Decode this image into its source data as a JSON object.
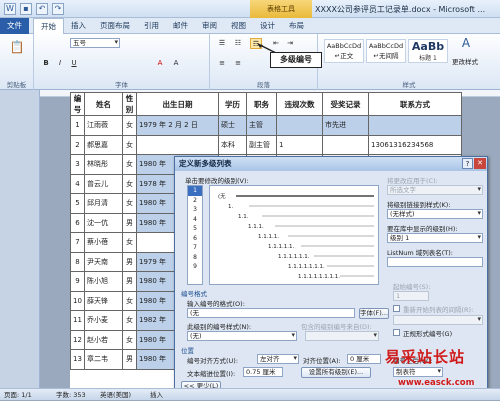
{
  "window": {
    "title": "XXXX公司参评员工记录单.docx - Microsoft ...",
    "context_tab": "表格工具"
  },
  "ribbon_tabs": [
    "文件",
    "开始",
    "插入",
    "页面布局",
    "引用",
    "邮件",
    "审阅",
    "视图",
    "设计",
    "布局"
  ],
  "ribbon": {
    "groups": [
      "剪贴板",
      "字体",
      "段落",
      "样式"
    ],
    "font_size": "五号",
    "styles": [
      "AaBbCcDd",
      "AaBbCcDd",
      "AaBb"
    ],
    "style_names": [
      "↵正文",
      "↵无间隔",
      "标题 1"
    ],
    "change_styles": "更改样式",
    "callout": "多级编号"
  },
  "table": {
    "headers": [
      "编号",
      "姓名",
      "性别",
      "出生日期",
      "学历",
      "职务",
      "违规次数",
      "受奖记录",
      "联系方式"
    ],
    "rows": [
      [
        "1",
        "江雨薇",
        "女",
        "1979 年 2 月 2 日",
        "硕士",
        "主管",
        "",
        "市先进",
        ""
      ],
      [
        "2",
        "郝思嘉",
        "女",
        "",
        "本科",
        "副主管",
        "1",
        "",
        "13061316234568"
      ],
      [
        "3",
        "林晓彤",
        "女",
        "1980 年",
        "",
        "",
        "",
        "",
        ""
      ],
      [
        "4",
        "曾云儿",
        "女",
        "1978 年",
        "",
        "",
        "",
        "",
        ""
      ],
      [
        "5",
        "邱月清",
        "女",
        "1980 年",
        "",
        "",
        "",
        "",
        ""
      ],
      [
        "6",
        "沈一伉",
        "男",
        "1980 年",
        "",
        "",
        "",
        "",
        ""
      ],
      [
        "7",
        "蔡小蓓",
        "女",
        "",
        "",
        "",
        "",
        "",
        ""
      ],
      [
        "8",
        "尹天南",
        "男",
        "1979 年",
        "",
        "",
        "",
        "",
        ""
      ],
      [
        "9",
        "陈小旭",
        "男",
        "1980 年",
        "",
        "",
        "",
        "",
        ""
      ],
      [
        "10",
        "薛天锋",
        "女",
        "1980 年",
        "",
        "",
        "",
        "",
        ""
      ],
      [
        "11",
        "乔小麦",
        "女",
        "1982 年",
        "",
        "",
        "",
        "",
        ""
      ],
      [
        "12",
        "赵小若",
        "女",
        "1980 年",
        "",
        "",
        "",
        "",
        ""
      ],
      [
        "13",
        "章二韦",
        "男",
        "1980 年",
        "",
        "",
        "",
        "",
        ""
      ]
    ]
  },
  "dialog": {
    "title": "定义新多级列表",
    "click_level": "单击要修改的级别(V):",
    "levels": [
      "1",
      "2",
      "3",
      "4",
      "5",
      "6",
      "7",
      "8",
      "9"
    ],
    "preview_lines": [
      "(无",
      "1.",
      "1.1.",
      "1.1.1.",
      "1.1.1.1.",
      "1.1.1.1.1.",
      "1.1.1.1.1.1.",
      "1.1.1.1.1.1.1.",
      "1.1.1.1.1.1.1.1."
    ],
    "apply_to_label": "将更改应用于(C):",
    "apply_to_value": "所选文字",
    "link_style_label": "将级别链接到样式(K):",
    "link_style_value": "(无样式)",
    "gallery_level_label": "要在库中显示的级别(H):",
    "gallery_level_value": "级别 1",
    "listnum_label": "ListNum 域列表名(T):",
    "number_format_section": "编号格式",
    "number_format_label": "输入编号的格式(O):",
    "number_format_value": "(无",
    "font_button": "字体(F)...",
    "number_style_label": "此级别的编号样式(N):",
    "number_style_value": "(无)",
    "include_level_label": "包含的级别编号来自(D):",
    "start_at_label": "起始编号(S):",
    "start_at_value": "1",
    "restart_label": "重新开始列表的间隔(R):",
    "legal_label": "正规形式编号(G)",
    "position_section": "位置",
    "align_label": "编号对齐方式(U):",
    "align_value": "左对齐",
    "aligned_at_label": "对齐位置(A):",
    "aligned_at_value": "0 厘米",
    "indent_label": "文本缩进位置(I):",
    "indent_value": "0.75 厘米",
    "set_all_button": "设置所有级别(E)...",
    "follow_label": "编号之后(W):",
    "follow_value": "制表符",
    "less_button": "<< 更少(L)"
  },
  "status": {
    "page": "页面: 1/1",
    "words": "字数: 353",
    "lang": "英语(美国)",
    "mode": "插入"
  },
  "watermark": {
    "text": "易采站长站",
    "url": "www.easck.com"
  }
}
